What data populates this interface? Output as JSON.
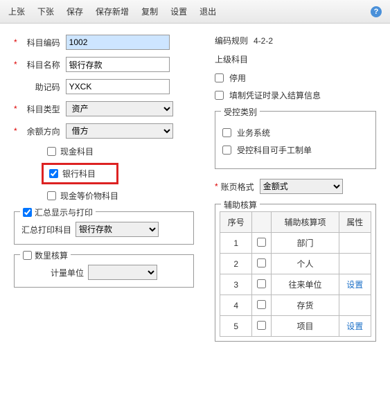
{
  "toolbar": {
    "items": [
      "上张",
      "下张",
      "保存",
      "保存新增",
      "复制",
      "设置",
      "退出"
    ],
    "help": "?"
  },
  "left": {
    "code_lbl": "科目编码",
    "code_val": "1002",
    "name_lbl": "科目名称",
    "name_val": "银行存款",
    "mnemonic_lbl": "助记码",
    "mnemonic_val": "YXCK",
    "type_lbl": "科目类型",
    "type_val": "资产",
    "dir_lbl": "余额方向",
    "dir_val": "借方",
    "cash": "现金科目",
    "bank": "银行科目",
    "cashEq": "现金等价物科目",
    "group_sum": "汇总显示与打印",
    "sum_print_lbl": "汇总打印科目",
    "sum_print_val": "银行存款",
    "group_qty": "数里核算",
    "unit_lbl": "计量单位"
  },
  "right": {
    "rule_lbl": "编码规则",
    "rule_val": "4-2-2",
    "parent_lbl": "上级科目",
    "disable": "停用",
    "settle": "填制凭证时录入结算信息",
    "group_ctrl": "受控类别",
    "biz": "业务系统",
    "manual": "受控科目可手工制单",
    "fmt_lbl": "账页格式",
    "fmt_val": "金额式",
    "group_aux": "辅助核算",
    "th": {
      "no": "序号",
      "chk": "",
      "item": "辅助核算项",
      "attr": "属性"
    },
    "rows": [
      {
        "no": "1",
        "item": "部门",
        "attr": ""
      },
      {
        "no": "2",
        "item": "个人",
        "attr": ""
      },
      {
        "no": "3",
        "item": "往来单位",
        "attr": "设置"
      },
      {
        "no": "4",
        "item": "存货",
        "attr": ""
      },
      {
        "no": "5",
        "item": "项目",
        "attr": "设置"
      }
    ]
  }
}
